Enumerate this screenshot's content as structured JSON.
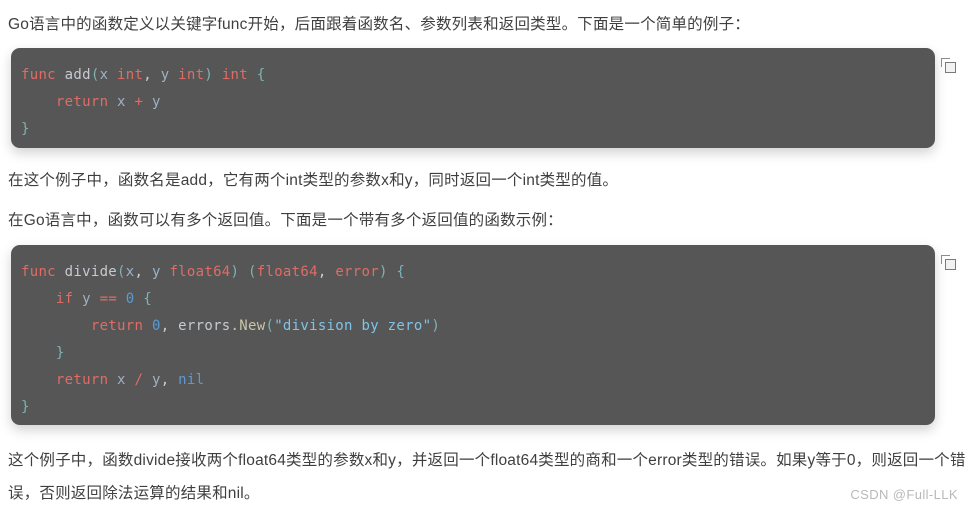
{
  "document": {
    "language_topic": "Go",
    "watermark": "CSDN @Full-LLK"
  },
  "paragraphs": {
    "intro": "Go语言中的函数定义以关键字func开始，后面跟着函数名、参数列表和返回类型。下面是一个简单的例子：",
    "mid1": "在这个例子中，函数名是add，它有两个int类型的参数x和y，同时返回一个int类型的值。",
    "mid2": "在Go语言中，函数可以有多个返回值。下面是一个带有多个返回值的函数示例：",
    "outro": "这个例子中，函数divide接收两个float64类型的参数x和y，并返回一个float64类型的商和一个error类型的错误。如果y等于0，则返回一个错误，否则返回除法运算的结果和nil。"
  },
  "code_blocks": [
    {
      "id": "code-block-1",
      "language": "go",
      "copy_button_label": "copy-icon",
      "plain_text": "func add(x int, y int) int {\n    return x + y\n}",
      "lines": [
        [
          {
            "text": "func",
            "token": "keyword"
          },
          {
            "text": " ",
            "token": "plain"
          },
          {
            "text": "add",
            "token": "function"
          },
          {
            "text": "(",
            "token": "punctuation"
          },
          {
            "text": "x",
            "token": "variable"
          },
          {
            "text": " ",
            "token": "plain"
          },
          {
            "text": "int",
            "token": "keyword"
          },
          {
            "text": ", ",
            "token": "plain"
          },
          {
            "text": "y",
            "token": "variable"
          },
          {
            "text": " ",
            "token": "plain"
          },
          {
            "text": "int",
            "token": "keyword"
          },
          {
            "text": ")",
            "token": "punctuation"
          },
          {
            "text": " ",
            "token": "plain"
          },
          {
            "text": "int",
            "token": "keyword"
          },
          {
            "text": " ",
            "token": "plain"
          },
          {
            "text": "{",
            "token": "punctuation"
          }
        ],
        [
          {
            "text": "    ",
            "token": "plain"
          },
          {
            "text": "return",
            "token": "keyword"
          },
          {
            "text": " ",
            "token": "plain"
          },
          {
            "text": "x",
            "token": "variable"
          },
          {
            "text": " ",
            "token": "plain"
          },
          {
            "text": "+",
            "token": "operator"
          },
          {
            "text": " ",
            "token": "plain"
          },
          {
            "text": "y",
            "token": "variable"
          }
        ],
        [
          {
            "text": "}",
            "token": "punctuation"
          }
        ]
      ]
    },
    {
      "id": "code-block-2",
      "language": "go",
      "copy_button_label": "copy-icon",
      "plain_text": "func divide(x, y float64) (float64, error) {\n    if y == 0 {\n        return 0, errors.New(\"division by zero\")\n    }\n    return x / y, nil\n}",
      "lines": [
        [
          {
            "text": "func",
            "token": "keyword"
          },
          {
            "text": " ",
            "token": "plain"
          },
          {
            "text": "divide",
            "token": "function"
          },
          {
            "text": "(",
            "token": "punctuation"
          },
          {
            "text": "x",
            "token": "variable"
          },
          {
            "text": ", ",
            "token": "plain"
          },
          {
            "text": "y",
            "token": "variable"
          },
          {
            "text": " ",
            "token": "plain"
          },
          {
            "text": "float64",
            "token": "keyword"
          },
          {
            "text": ")",
            "token": "punctuation"
          },
          {
            "text": " ",
            "token": "plain"
          },
          {
            "text": "(",
            "token": "punctuation"
          },
          {
            "text": "float64",
            "token": "keyword"
          },
          {
            "text": ", ",
            "token": "plain"
          },
          {
            "text": "error",
            "token": "keyword"
          },
          {
            "text": ")",
            "token": "punctuation"
          },
          {
            "text": " ",
            "token": "plain"
          },
          {
            "text": "{",
            "token": "punctuation"
          }
        ],
        [
          {
            "text": "    ",
            "token": "plain"
          },
          {
            "text": "if",
            "token": "keyword"
          },
          {
            "text": " ",
            "token": "plain"
          },
          {
            "text": "y",
            "token": "variable"
          },
          {
            "text": " ",
            "token": "plain"
          },
          {
            "text": "==",
            "token": "operator"
          },
          {
            "text": " ",
            "token": "plain"
          },
          {
            "text": "0",
            "token": "number"
          },
          {
            "text": " ",
            "token": "plain"
          },
          {
            "text": "{",
            "token": "punctuation"
          }
        ],
        [
          {
            "text": "        ",
            "token": "plain"
          },
          {
            "text": "return",
            "token": "keyword"
          },
          {
            "text": " ",
            "token": "plain"
          },
          {
            "text": "0",
            "token": "number"
          },
          {
            "text": ", ",
            "token": "plain"
          },
          {
            "text": "errors",
            "token": "function"
          },
          {
            "text": ".New",
            "token": "method"
          },
          {
            "text": "(",
            "token": "punctuation"
          },
          {
            "text": "\"division by zero\"",
            "token": "string"
          },
          {
            "text": ")",
            "token": "punctuation"
          }
        ],
        [
          {
            "text": "    ",
            "token": "plain"
          },
          {
            "text": "}",
            "token": "punctuation"
          }
        ],
        [
          {
            "text": "    ",
            "token": "plain"
          },
          {
            "text": "return",
            "token": "keyword"
          },
          {
            "text": " ",
            "token": "plain"
          },
          {
            "text": "x",
            "token": "variable"
          },
          {
            "text": " ",
            "token": "plain"
          },
          {
            "text": "/",
            "token": "operator"
          },
          {
            "text": " ",
            "token": "plain"
          },
          {
            "text": "y",
            "token": "variable"
          },
          {
            "text": ", ",
            "token": "plain"
          },
          {
            "text": "nil",
            "token": "nil"
          }
        ],
        [
          {
            "text": "}",
            "token": "punctuation"
          }
        ]
      ]
    }
  ],
  "colors": {
    "code_background": "#565656",
    "page_background": "#ffffff",
    "body_text": "#3f3f3f",
    "keyword": "#e06c66",
    "function": "#c5cbd0",
    "method": "#c7c4a8",
    "punctuation": "#7fb3b3",
    "variable": "#9fb2c4",
    "number": "#5b9bd5",
    "string": "#7fc4e8",
    "nil": "#5b9bd5",
    "operator": "#e06c66",
    "plain": "#c8cdd2",
    "watermark": "#b9b9b9"
  }
}
